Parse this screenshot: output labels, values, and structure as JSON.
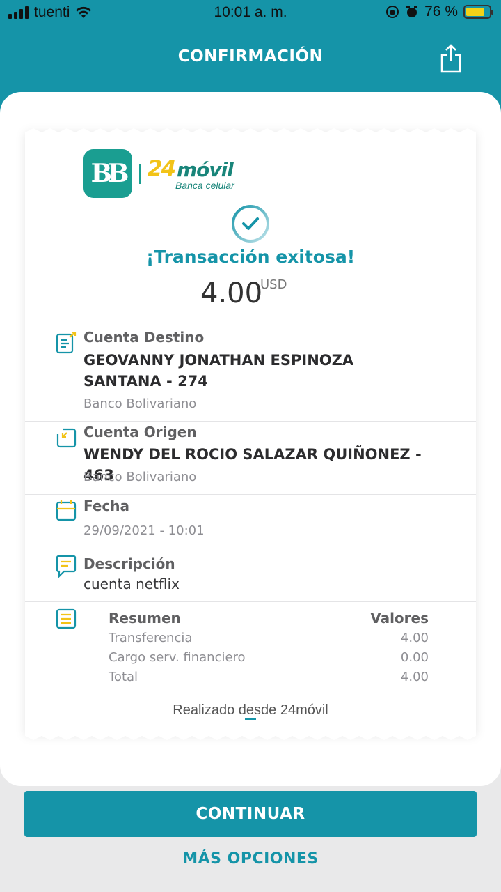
{
  "status_bar": {
    "carrier": "tuenti",
    "time": "10:01 a. m.",
    "battery": "76 %"
  },
  "header": {
    "title": "CONFIRMACIÓN"
  },
  "logo": {
    "brand_number": "24",
    "brand_word": "móvil",
    "brand_tagline": "Banca celular",
    "bank_mark": "BB"
  },
  "transaction": {
    "status": "¡Transacción exitosa!",
    "amount": "4.00",
    "currency": "USD"
  },
  "details": {
    "destino": {
      "label": "Cuenta Destino",
      "name": "GEOVANNY JONATHAN ESPINOZA SANTANA - 274",
      "bank": "Banco Bolivariano"
    },
    "origen": {
      "label": "Cuenta Origen",
      "name": "WENDY DEL ROCIO SALAZAR QUIÑONEZ - 463",
      "bank": "Banco Bolivariano"
    },
    "fecha": {
      "label": "Fecha",
      "value": "29/09/2021 - 10:01"
    },
    "descripcion": {
      "label": "Descripción",
      "value": "cuenta netflix"
    }
  },
  "summary": {
    "label": "Resumen",
    "values_label": "Valores",
    "rows": [
      {
        "name": "Transferencia",
        "value": "4.00"
      },
      {
        "name": "Cargo serv. financiero",
        "value": "0.00"
      },
      {
        "name": "Total",
        "value": "4.00"
      }
    ]
  },
  "footer_note": "Realizado desde 24móvil",
  "buttons": {
    "continue": "CONTINUAR",
    "more": "MÁS OPCIONES"
  },
  "colors": {
    "primary": "#1594a8",
    "logo_green": "#1a9e91",
    "logo_yellow": "#f2c318"
  },
  "icons": [
    "signal-icon",
    "wifi-icon",
    "orientation-lock-icon",
    "alarm-icon",
    "battery-icon",
    "share-icon",
    "check-circle-icon",
    "account-destination-icon",
    "account-origin-icon",
    "calendar-icon",
    "chat-icon",
    "list-icon"
  ]
}
